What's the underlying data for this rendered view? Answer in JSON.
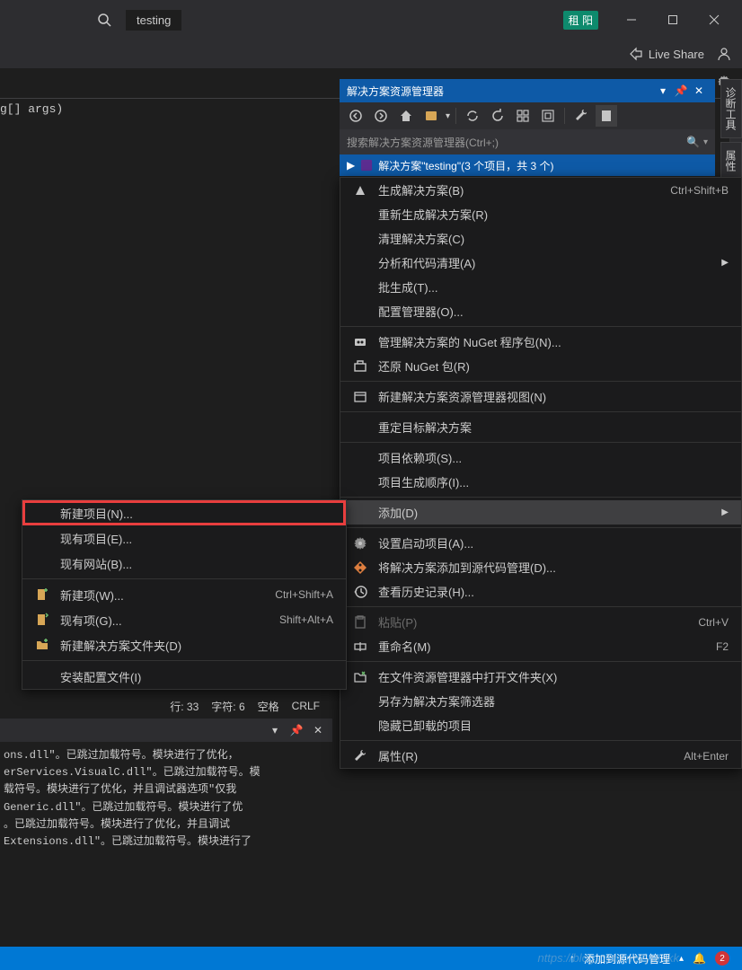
{
  "titlebar": {
    "project": "testing",
    "user_badge": "租 阳"
  },
  "toolbar2": {
    "live_share": "Live Share"
  },
  "code": {
    "line": "g[] args)"
  },
  "solution": {
    "title": "解决方案资源管理器",
    "search_placeholder": "搜索解决方案资源管理器(Ctrl+;)",
    "root": "解决方案\"testing\"(3 个项目，共 3 个)"
  },
  "side_tabs": [
    "诊断工具",
    "属性"
  ],
  "context_menu": [
    {
      "icon": "build",
      "label": "生成解决方案(B)",
      "shortcut": "Ctrl+Shift+B"
    },
    {
      "label": "重新生成解决方案(R)"
    },
    {
      "label": "清理解决方案(C)"
    },
    {
      "label": "分析和代码清理(A)",
      "arrow": true
    },
    {
      "label": "批生成(T)..."
    },
    {
      "label": "配置管理器(O)..."
    },
    {
      "sep": true
    },
    {
      "icon": "nuget",
      "label": "管理解决方案的 NuGet 程序包(N)..."
    },
    {
      "icon": "restore",
      "label": "还原 NuGet 包(R)"
    },
    {
      "sep": true
    },
    {
      "icon": "newview",
      "label": "新建解决方案资源管理器视图(N)"
    },
    {
      "sep": true
    },
    {
      "label": "重定目标解决方案"
    },
    {
      "sep": true
    },
    {
      "label": "项目依赖项(S)..."
    },
    {
      "label": "项目生成顺序(I)..."
    },
    {
      "sep": true
    },
    {
      "label": "添加(D)",
      "arrow": true,
      "hover": true
    },
    {
      "sep": true
    },
    {
      "icon": "gear",
      "label": "设置启动项目(A)..."
    },
    {
      "icon": "git",
      "label": "将解决方案添加到源代码管理(D)..."
    },
    {
      "icon": "history",
      "label": "查看历史记录(H)..."
    },
    {
      "sep": true
    },
    {
      "icon": "paste",
      "label": "粘贴(P)",
      "shortcut": "Ctrl+V",
      "disabled": true
    },
    {
      "icon": "rename",
      "label": "重命名(M)",
      "shortcut": "F2"
    },
    {
      "sep": true
    },
    {
      "icon": "folder",
      "label": "在文件资源管理器中打开文件夹(X)"
    },
    {
      "label": "另存为解决方案筛选器"
    },
    {
      "label": "隐藏已卸载的项目"
    },
    {
      "sep": true
    },
    {
      "icon": "wrench",
      "label": "属性(R)",
      "shortcut": "Alt+Enter"
    }
  ],
  "submenu": [
    {
      "label": "新建项目(N)...",
      "highlight": true
    },
    {
      "label": "现有项目(E)..."
    },
    {
      "label": "现有网站(B)..."
    },
    {
      "sep": true
    },
    {
      "icon": "newitem",
      "label": "新建项(W)...",
      "shortcut": "Ctrl+Shift+A"
    },
    {
      "icon": "existitem",
      "label": "现有项(G)...",
      "shortcut": "Shift+Alt+A"
    },
    {
      "icon": "newfolder",
      "label": "新建解决方案文件夹(D)"
    },
    {
      "sep": true
    },
    {
      "label": "安装配置文件(I)"
    }
  ],
  "status_line": {
    "row": "行: 33",
    "col": "字符: 6",
    "spaces": "空格",
    "crlf": "CRLF"
  },
  "output": {
    "text": "ons.dll\"。已跳过加载符号。模块进行了优化，\nerServices.VisualC.dll\"。已跳过加载符号。模\n载符号。模块进行了优化，并且调试器选项\"仅我\nGeneric.dll\"。已跳过加载符号。模块进行了优\n。已跳过加载符号。模块进行了优化，并且调试\nExtensions.dll\"。已跳过加载符号。模块进行了"
  },
  "statusbar": {
    "add_source": "添加到源代码管理",
    "notify_count": "2"
  },
  "watermark": "nttps://blog.csdn.net/yumkk"
}
